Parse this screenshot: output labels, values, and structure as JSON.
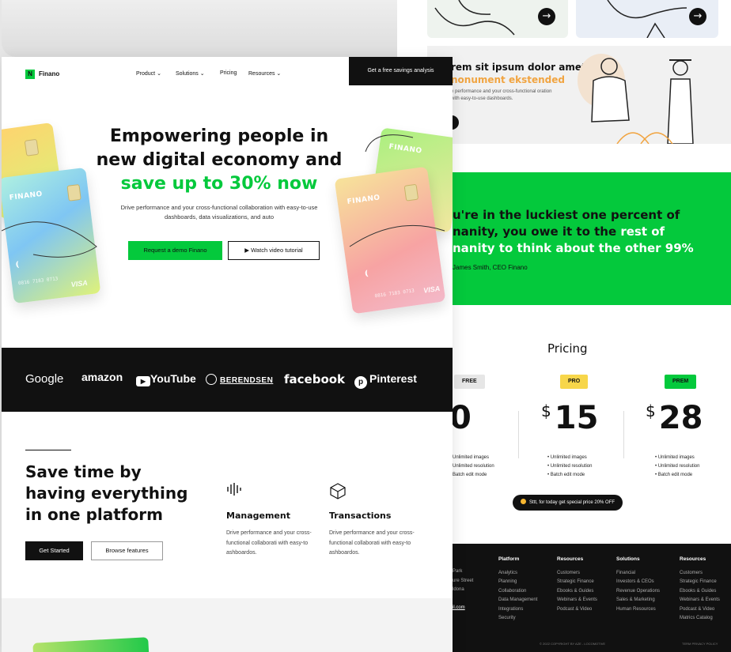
{
  "back": {
    "blog": {
      "title_line1": "rem sit ipsum dolor amet",
      "title_line2": "nonument ekstended",
      "text": "e performance and your cross-functional oration with easy-to-use dashboards."
    },
    "quote": {
      "line1": "u're in the luckiest one percent of",
      "line2_a": "nanity, you owe it to the ",
      "line2_b": "rest of",
      "line3": "nanity to think about the other 99%",
      "author": "James Smith, CEO Finano"
    },
    "pricing": {
      "title": "Pricing",
      "plans": [
        {
          "badge": "FREE",
          "price": "0",
          "currency": "",
          "features": [
            "Unlimited images",
            "Unlimited resolution",
            "Batch edit mode"
          ],
          "badge_color": "#e6e6e6"
        },
        {
          "badge": "PRO",
          "price": "15",
          "currency": "$",
          "features": [
            "Unlimited images",
            "Unlimited resolution",
            "Batch edit mode"
          ],
          "badge_color": "#f7d64a"
        },
        {
          "badge": "PREM",
          "price": "28",
          "currency": "$",
          "features": [
            "Unlimited images",
            "Unlimited resolution",
            "Batch edit mode"
          ],
          "badge_color": "#04c93c"
        }
      ],
      "promo": "Sttt, for today get special price 20% OFF"
    },
    "footer": {
      "address": [
        "Park",
        "ure Street",
        "ldona",
        "",
        "il.com"
      ],
      "columns": [
        {
          "heading": "Platform",
          "items": [
            "Analytics",
            "Planning",
            "Collaboration",
            "Data Management",
            "Integrations",
            "Security"
          ]
        },
        {
          "heading": "Resources",
          "items": [
            "Customers",
            "Strategic Finance",
            "Ebooks & Guides",
            "Webinars & Events",
            "Podcast & Video"
          ]
        },
        {
          "heading": "Solutions",
          "items": [
            "Financial",
            "Investors & CEOs",
            "Revenue Operations",
            "Sales & Marketing",
            "Human Resources"
          ]
        },
        {
          "heading": "Resources",
          "items": [
            "Customers",
            "Strategic Finance",
            "Ebooks & Guides",
            "Webinars & Events",
            "Podcast & Video",
            "Matrics Catalog"
          ]
        }
      ],
      "copyright": "© 2022 COPYRIGHT BY AZE - LOCOMOTIVE",
      "terms": "TERM PRIVACY POLICY"
    }
  },
  "front": {
    "nav": {
      "logo_mark": "N",
      "logo": "Finano",
      "links": [
        "Product",
        "Solutions",
        "Pricing",
        "Resources"
      ],
      "cta": "Get a free savings analysis"
    },
    "hero": {
      "title_line1": "Empowering people in",
      "title_line2": "new digital economy and",
      "title_line3": "save up to 30% now",
      "subtitle": "Drive performance and your cross-functional collaboration with easy-to-use dashboards, data visualizations, and auto",
      "primary_button": "Request a demo Finano",
      "secondary_button": "▶ Watch video tutorial"
    },
    "cards": {
      "brand": "FINANO",
      "number": "0816 7183 0713",
      "network": "VISA"
    },
    "logos": [
      "Google",
      "amazon",
      "YouTube",
      "BERENDSEN",
      "facebook",
      "Pinterest"
    ],
    "features": {
      "title": "Save time by having everything in one platform",
      "primary_button": "Get Started",
      "secondary_button": "Browse features",
      "items": [
        {
          "title": "Management",
          "desc": "Drive performance and your cross-functional collaborati with easy-to ashboardos."
        },
        {
          "title": "Transactions",
          "desc": "Drive performance and your cross-functional collaborati with easy-to ashboardos."
        }
      ]
    }
  }
}
